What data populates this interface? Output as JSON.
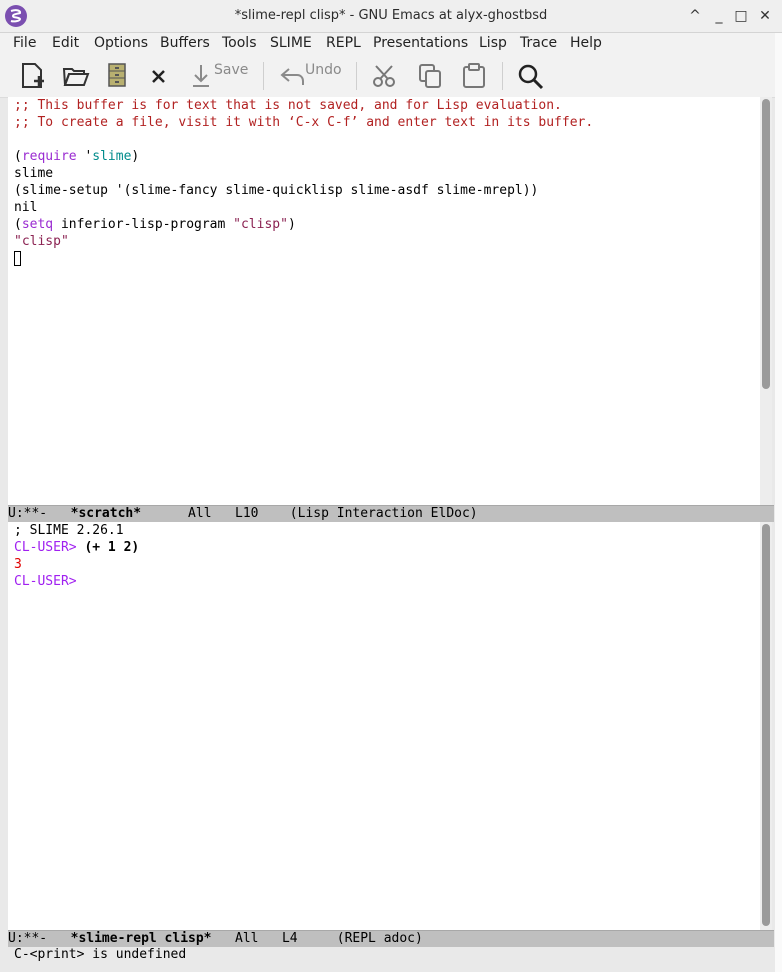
{
  "window": {
    "title": "*slime-repl clisp* - GNU Emacs at alyx-ghostbsd",
    "controls": [
      "^",
      "_",
      "□",
      "×"
    ]
  },
  "menu": [
    "File",
    "Edit",
    "Options",
    "Buffers",
    "Tools",
    "SLIME",
    "REPL",
    "Presentations",
    "Lisp",
    "Trace",
    "Help"
  ],
  "toolbar": {
    "save_label": "Save",
    "undo_label": "Undo"
  },
  "scratch": {
    "comment1": ";; This buffer is for text that is not saved, and for Lisp evaluation.",
    "comment2": ";; To create a file, visit it with ‘C-x C-f’ and enter text in its buffer.",
    "l4_open": "(",
    "l4_kw": "require",
    "l4_sp": " '",
    "l4_sym": "slime",
    "l4_close": ")",
    "l5": "slime",
    "l6": "(slime-setup '(slime-fancy slime-quicklisp slime-asdf slime-mrepl))",
    "l7": "nil",
    "l8_open": "(",
    "l8_kw": "setq",
    "l8_mid": " inferior-lisp-program ",
    "l8_str": "\"clisp\"",
    "l8_close": ")",
    "l9": "\"clisp\""
  },
  "modeline1": {
    "status": "U:**-   ",
    "buffer": "*scratch*",
    "rest": "      All   L10    (Lisp Interaction ElDoc)"
  },
  "repl": {
    "banner": "; SLIME 2.26.1",
    "prompt1": "CL-USER>",
    "input1": " (+ 1 2)",
    "output1": "3",
    "prompt2": "CL-USER>"
  },
  "modeline2": {
    "status": "U:**-   ",
    "buffer": "*slime-repl clisp*",
    "rest": "   All   L4     (REPL adoc)"
  },
  "echo": "C-<print> is undefined"
}
